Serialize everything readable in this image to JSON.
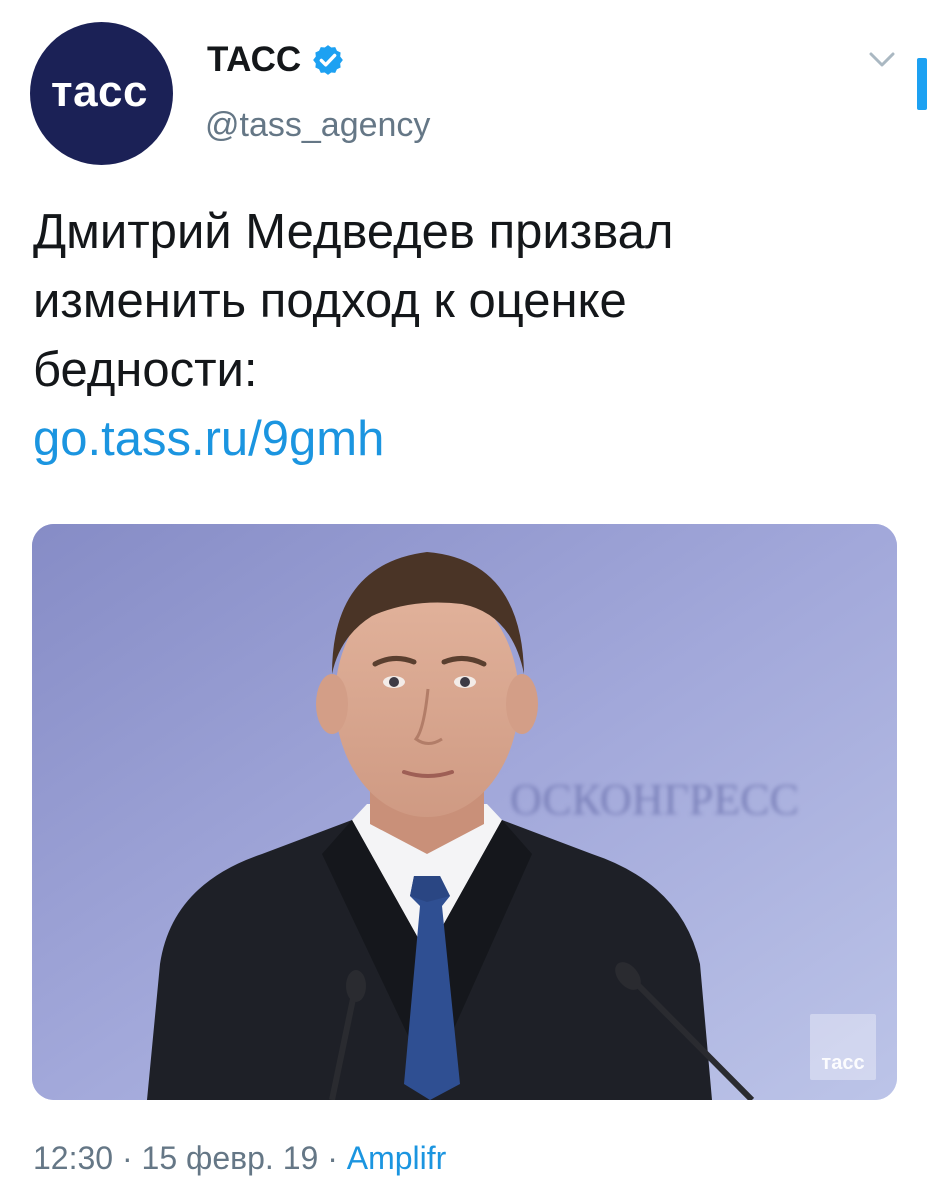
{
  "author": {
    "avatar_text": "тасс",
    "display_name": "ТАСС",
    "handle": "@tass_agency",
    "verified": true
  },
  "tweet": {
    "text_lines": [
      "Дмитрий Медведев призвал",
      "изменить подход к оценке",
      "бедности:"
    ],
    "link": "go.tass.ru/9gmh"
  },
  "media": {
    "backdrop_text": "ОСКОНГРЕСС",
    "watermark_text": "тасс"
  },
  "meta": {
    "time": "12:30",
    "separator": " · ",
    "date": "15 февр. 19",
    "source": "Amplifr"
  },
  "colors": {
    "link": "#1b95e0",
    "avatar_bg": "#1b2156",
    "muted": "#657786"
  },
  "icons": [
    "verified-badge-icon",
    "chevron-down-icon"
  ]
}
